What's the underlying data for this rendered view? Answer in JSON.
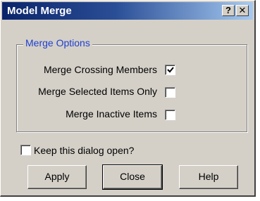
{
  "window": {
    "title": "Model Merge",
    "help_button": "?",
    "close_button": "✕"
  },
  "merge_options": {
    "legend": "Merge Options",
    "options": [
      {
        "label": "Merge Crossing Members",
        "checked": true
      },
      {
        "label": "Merge Selected Items Only",
        "checked": false
      },
      {
        "label": "Merge Inactive Items",
        "checked": false
      }
    ]
  },
  "keep_open": {
    "label": "Keep this dialog open?",
    "checked": false
  },
  "buttons": {
    "apply": "Apply",
    "close": "Close",
    "help": "Help"
  },
  "colors": {
    "title_start": "#0a246a",
    "title_end": "#a6caf0",
    "legend": "#1f3fd0",
    "face": "#d4d0c8"
  }
}
